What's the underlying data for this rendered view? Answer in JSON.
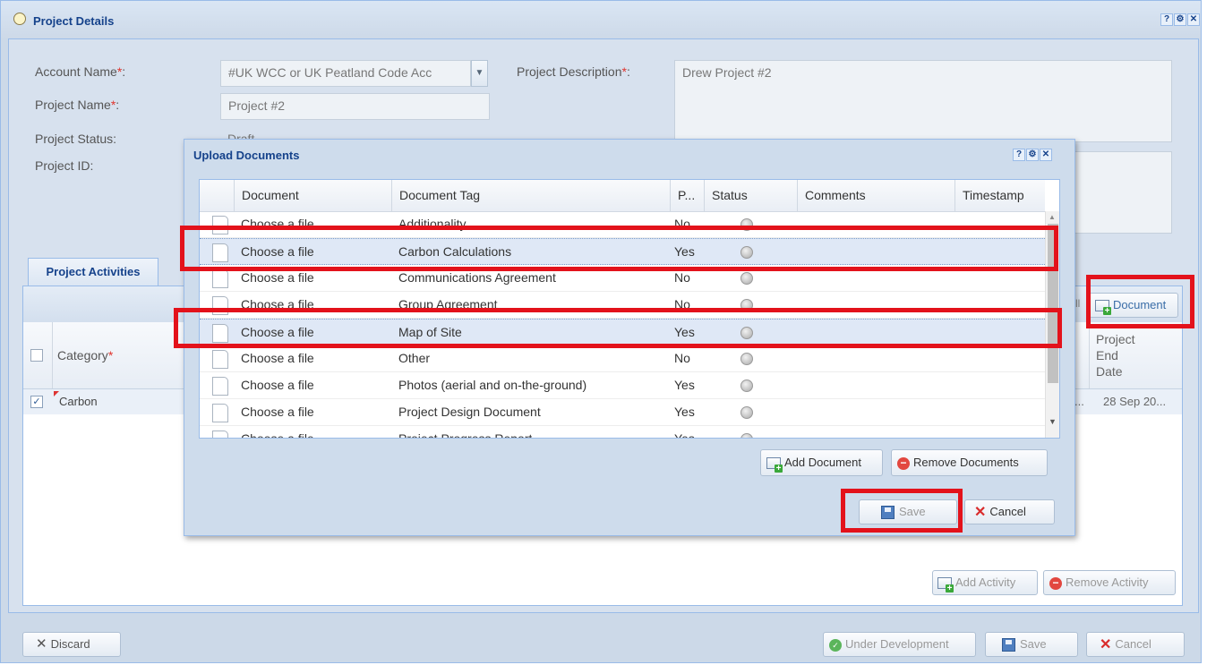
{
  "main": {
    "title": "Project Details",
    "tools": [
      "?",
      "⚙",
      "✕"
    ],
    "form": {
      "account_name_label": "Account Name",
      "account_name_value": "#UK WCC or UK Peatland Code Acc",
      "project_name_label": "Project Name",
      "project_name_value": "Project #2",
      "project_status_label": "Project Status:",
      "project_status_value": "Draft",
      "project_id_label": "Project ID:",
      "project_description_label": "Project Description",
      "project_description_value": "Drew Project #2",
      "required_marker": "*",
      "colon": ":"
    },
    "activities": {
      "tab_label": "Project Activities",
      "toolbar_document_button": "Document",
      "toolbar_partial": "ll",
      "category_header": "Category",
      "end_date_header": "Project End Date",
      "row_category": "Carbon",
      "row_ellipsis": "...",
      "row_end_date": "28 Sep 20...",
      "add_activity_button": "Add Activity",
      "remove_activity_button": "Remove Activity"
    },
    "footer": {
      "discard_button": "Discard",
      "under_development_button": "Under Development",
      "save_button": "Save",
      "cancel_button": "Cancel"
    }
  },
  "modal": {
    "title": "Upload Documents",
    "tools": [
      "?",
      "⚙",
      "✕"
    ],
    "columns": [
      "Document",
      "Document Tag",
      "P...",
      "Status",
      "Comments",
      "Timestamp"
    ],
    "rows": [
      {
        "document": "Choose a file",
        "tag": "Additionality",
        "p": "No"
      },
      {
        "document": "Choose a file",
        "tag": "Carbon Calculations",
        "p": "Yes"
      },
      {
        "document": "Choose a file",
        "tag": "Communications Agreement",
        "p": "No"
      },
      {
        "document": "Choose a file",
        "tag": "Group Agreement",
        "p": "No"
      },
      {
        "document": "Choose a file",
        "tag": "Map of Site",
        "p": "Yes"
      },
      {
        "document": "Choose a file",
        "tag": "Other",
        "p": "No"
      },
      {
        "document": "Choose a file",
        "tag": "Photos (aerial and on-the-ground)",
        "p": "Yes"
      },
      {
        "document": "Choose a file",
        "tag": "Project Design Document",
        "p": "Yes"
      },
      {
        "document": "Choose a file",
        "tag": "Project Progress Report",
        "p": "Yes"
      }
    ],
    "add_document_button": "Add Document",
    "remove_documents_button": "Remove Documents",
    "save_button": "Save",
    "cancel_button": "Cancel"
  },
  "colors": {
    "panel_bg": "#ccd9e8",
    "header_text": "#15428b",
    "highlight_box": "#e3121b",
    "selected_row": "#dfe8f6"
  }
}
